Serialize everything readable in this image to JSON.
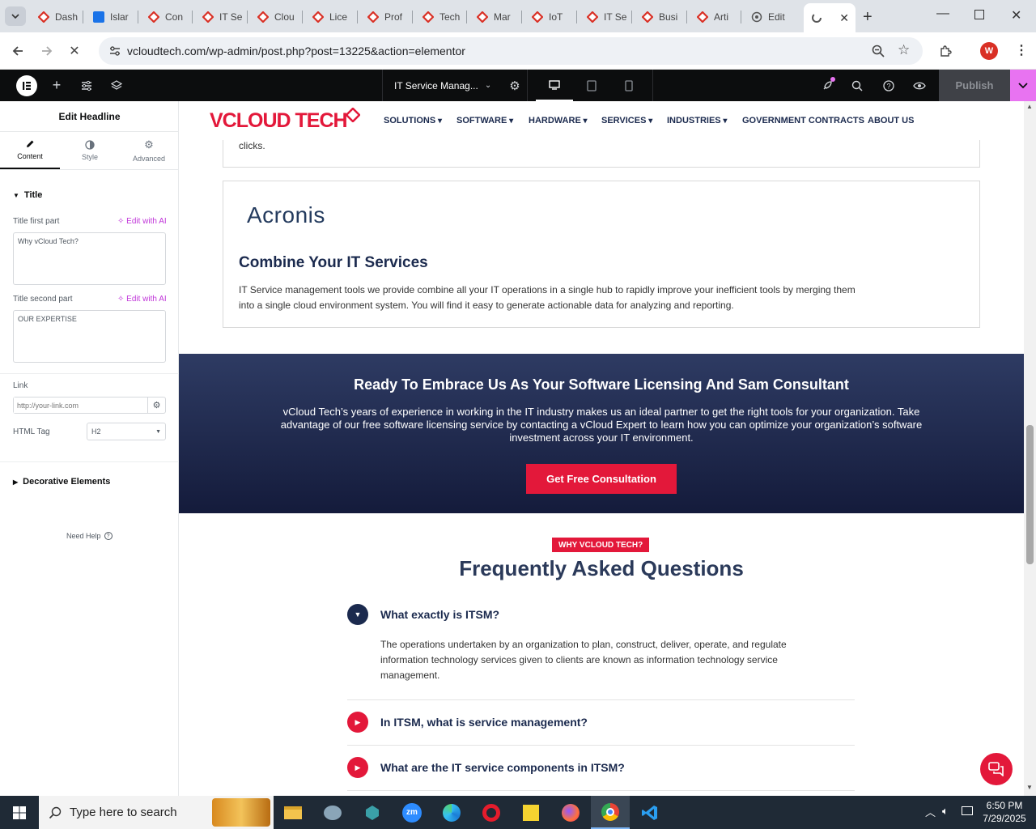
{
  "browser": {
    "tabs": [
      {
        "label": "Dash",
        "icon": "elementor-icon"
      },
      {
        "label": "Islar",
        "icon": "blue-doc-icon"
      },
      {
        "label": "Con",
        "icon": "elementor-icon"
      },
      {
        "label": "IT Se",
        "icon": "elementor-icon"
      },
      {
        "label": "Clou",
        "icon": "elementor-icon"
      },
      {
        "label": "Lice",
        "icon": "elementor-icon"
      },
      {
        "label": "Prof",
        "icon": "elementor-icon"
      },
      {
        "label": "Tech",
        "icon": "elementor-icon"
      },
      {
        "label": "Mar",
        "icon": "elementor-icon"
      },
      {
        "label": "IoT",
        "icon": "elementor-icon"
      },
      {
        "label": "IT Se",
        "icon": "elementor-icon"
      },
      {
        "label": "Busi",
        "icon": "elementor-icon"
      },
      {
        "label": "Arti",
        "icon": "elementor-icon"
      },
      {
        "label": "Edit",
        "icon": "wordpress-icon"
      }
    ],
    "url": "vcloudtech.com/wp-admin/post.php?post=13225&action=elementor",
    "profile_initial": "W",
    "accent": "#d93025"
  },
  "elementor": {
    "page_name": "IT Service Manag...",
    "publish_label": "Publish"
  },
  "panel": {
    "title": "Edit Headline",
    "tabs": [
      {
        "label": "Content",
        "icon": "pencil-icon"
      },
      {
        "label": "Style",
        "icon": "half-circle-icon"
      },
      {
        "label": "Advanced",
        "icon": "gear-icon"
      }
    ],
    "section_title": "Title",
    "first_part_label": "Title first part",
    "first_part_value": "Why vCloud Tech?",
    "second_part_label": "Title second part",
    "second_part_value": "OUR EXPERTISE",
    "edit_ai_label": "Edit with AI",
    "link_label": "Link",
    "link_placeholder": "http://your-link.com",
    "html_tag_label": "HTML Tag",
    "html_tag_value": "H2",
    "decorative_label": "Decorative Elements",
    "help_label": "Need Help"
  },
  "site": {
    "logo_text": "VCLOUD TECH",
    "nav": [
      {
        "label": "SOLUTIONS",
        "caret": true
      },
      {
        "label": "SOFTWARE",
        "caret": true
      },
      {
        "label": "HARDWARE",
        "caret": true
      },
      {
        "label": "SERVICES",
        "caret": true
      },
      {
        "label": "INDUSTRIES",
        "caret": true
      },
      {
        "label": "GOVERNMENT CONTRACTS",
        "caret": false
      },
      {
        "label": "ABOUT US",
        "caret": false
      }
    ],
    "prev_card_tail": "clicks.",
    "acronis_logo": "Acronis",
    "card_heading": "Combine Your IT Services",
    "card_body_line1": "IT Service management tools we provide combine all your IT operations in a single hub to rapidly improve your inefficient tools by merging them",
    "card_body_line2": "into a single cloud environment system. You will find it easy to generate actionable data for analyzing and reporting.",
    "cta_heading": "Ready To Embrace Us As Your Software Licensing And Sam Consultant",
    "cta_body_line1": "vCloud Tech’s years of experience in working in the IT industry makes us an ideal partner to get the right tools for your organization. Take",
    "cta_body_line2": "advantage of our free software licensing service by contacting a vCloud Expert to learn how you can optimize your organization’s software",
    "cta_body_line3": "investment across your IT environment.",
    "cta_button": "Get Free Consultation",
    "faq_badge": "WHY VCLOUD TECH?",
    "faq_title": "Frequently Asked Questions",
    "faqs": [
      {
        "q": "What exactly is ITSM?",
        "open": true,
        "a1": "The operations undertaken by an organization to plan, construct, deliver, operate, and regulate",
        "a2": "information technology services given to clients are known as information technology service",
        "a3": "management."
      },
      {
        "q": "In ITSM, what is service management?",
        "open": false
      },
      {
        "q": "What are the IT service components in ITSM?",
        "open": false
      }
    ],
    "brand_red": "#e3183a",
    "brand_navy": "#1b2a4e"
  },
  "taskbar": {
    "search_placeholder": "Type here to search",
    "time": "6:50 PM",
    "date": "7/29/2025"
  }
}
